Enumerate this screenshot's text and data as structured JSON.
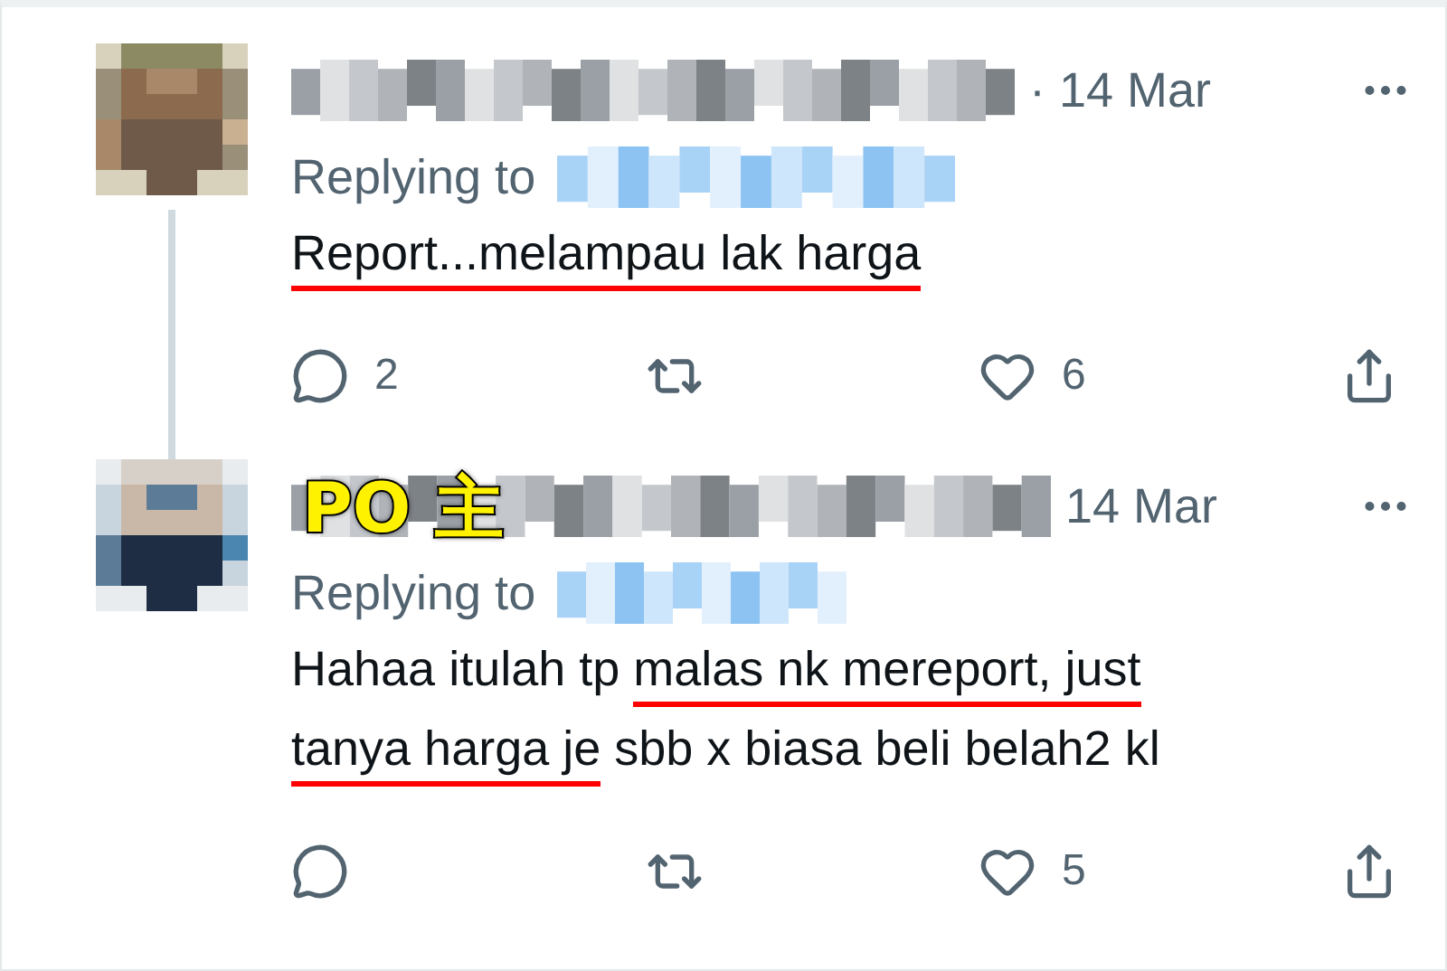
{
  "tweets": [
    {
      "avatar": {
        "kind": "picture"
      },
      "time": "· 14 Mar",
      "replying_to": "Replying to",
      "thread_line": true,
      "body": [
        [
          {
            "text": "Report...melampau lak harga",
            "marked": true
          }
        ]
      ],
      "actions": [
        {
          "kind": "reply",
          "count": "2"
        },
        {
          "kind": "retweet"
        },
        {
          "kind": "like",
          "count": "6"
        },
        {
          "kind": "share"
        }
      ]
    },
    {
      "avatar": {
        "kind": "picture"
      },
      "badge": "PO 主",
      "time": "14 Mar",
      "replying_to": "Replying to",
      "thread_line": false,
      "body": [
        [
          {
            "text": "Hahaa itulah tp ",
            "marked": false
          },
          {
            "text": "malas nk mereport, just",
            "marked": true
          }
        ],
        [
          {
            "text": "tanya harga je",
            "marked": true
          },
          {
            "text": " sbb x biasa beli belah2 kl",
            "marked": false
          }
        ]
      ],
      "actions": [
        {
          "kind": "reply"
        },
        {
          "kind": "retweet"
        },
        {
          "kind": "like",
          "count": "5"
        },
        {
          "kind": "share"
        }
      ]
    }
  ]
}
